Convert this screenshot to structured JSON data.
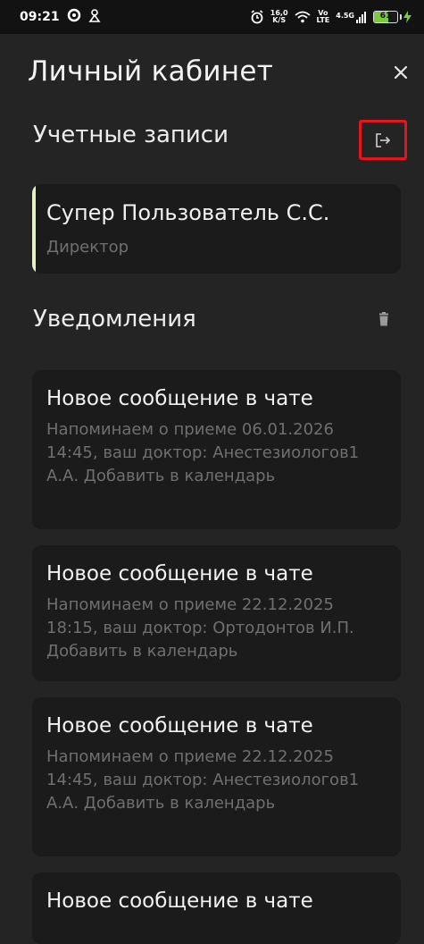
{
  "status_bar": {
    "time": "09:21",
    "net_speed_value": "16,0",
    "net_speed_unit": "K/S",
    "volte_top": "Vo",
    "volte_bottom": "LTE",
    "signal_label": "4.5G",
    "battery_percent": "61",
    "battery_level": 0.61,
    "battery_color": "#7ac943"
  },
  "header": {
    "title": "Личный кабинет",
    "close_icon": "close-icon"
  },
  "accounts": {
    "section_title": "Учетные записи",
    "logout_icon": "logout-icon",
    "highlight_color": "#e8141c",
    "items": [
      {
        "name": "Супер Пользователь С.С.",
        "role": "Директор"
      }
    ]
  },
  "notifications": {
    "section_title": "Уведомления",
    "delete_icon": "trash-icon",
    "items": [
      {
        "title": "Новое сообщение в чате",
        "body": "Напоминаем о приеме 06.01.2026 14:45, ваш доктор: Анестезиологов1 А.А. Добавить в календарь"
      },
      {
        "title": "Новое сообщение в чате",
        "body": "Напоминаем о приеме 22.12.2025 18:15, ваш доктор: Ортодонтов И.П. Добавить в календарь"
      },
      {
        "title": "Новое сообщение в чате",
        "body": "Напоминаем о приеме 22.12.2025 14:45, ваш доктор: Анестезиологов1 А.А. Добавить в календарь"
      },
      {
        "title": "Новое сообщение в чате",
        "body": ""
      }
    ]
  }
}
